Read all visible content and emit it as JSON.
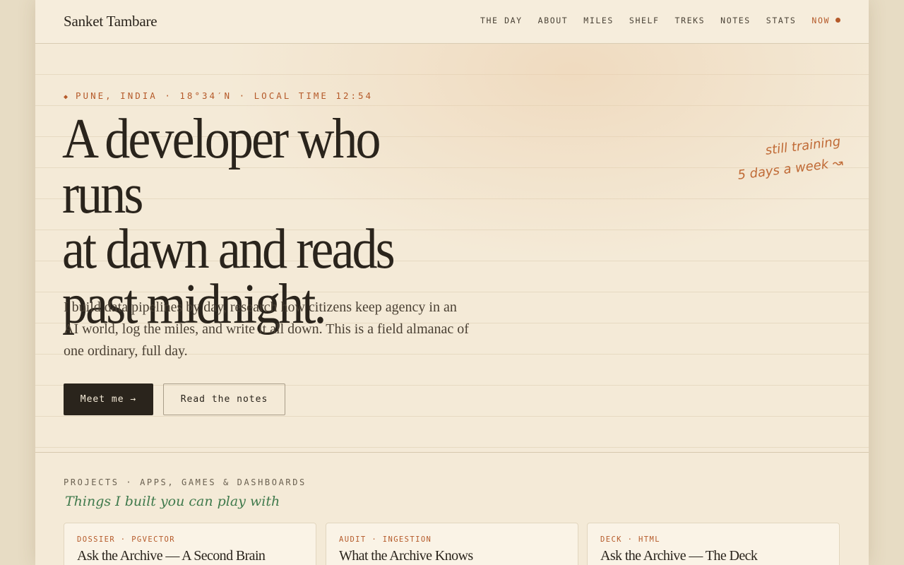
{
  "header": {
    "brand": "Sanket Tambare",
    "nav": [
      {
        "label": "THE DAY"
      },
      {
        "label": "ABOUT"
      },
      {
        "label": "MILES"
      },
      {
        "label": "SHELF"
      },
      {
        "label": "TREKS"
      },
      {
        "label": "NOTES"
      },
      {
        "label": "STATS"
      },
      {
        "label": "NOW"
      }
    ]
  },
  "hero": {
    "location": "PUNE, INDIA · 18°34′N · LOCAL TIME 12:54",
    "headline_lines": [
      "A developer who runs",
      "at dawn and reads",
      "past midnight."
    ],
    "lede": "I build data pipelines by day, research how citizens keep agency in an AI world, log the miles, and write it all down. This is a field almanac of one ordinary, full day.",
    "primary_button": "Meet me →",
    "secondary_button": "Read the notes",
    "note_lines": [
      "still training",
      "5 days a week ↝"
    ]
  },
  "projects": {
    "label": "PROJECTS · APPS, GAMES & DASHBOARDS",
    "script": "Things I built you can play with",
    "cards": [
      {
        "tag": "DOSSIER · PGVECTOR",
        "title": "Ask the Archive — A Second Brain"
      },
      {
        "tag": "AUDIT · INGESTION",
        "title": "What the Archive Knows"
      },
      {
        "tag": "DECK · HTML",
        "title": "Ask the Archive — The Deck"
      }
    ]
  },
  "colors": {
    "accent": "#b55a2a",
    "ink": "#2a241c",
    "paper": "#f4ead7",
    "script_green": "#3f7a4c"
  }
}
